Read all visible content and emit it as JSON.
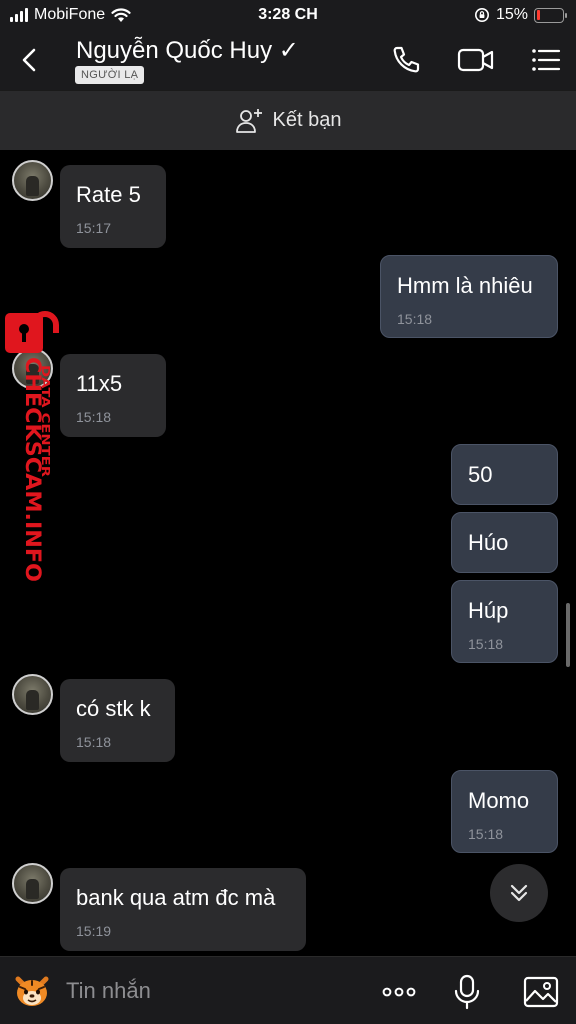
{
  "status_bar": {
    "carrier": "MobiFone",
    "time": "3:28 CH",
    "battery": "15%",
    "battery_level": 0.15,
    "battery_color": "#ff3b30"
  },
  "header": {
    "contact_name": "Nguyễn Quốc Huy ✓",
    "badge": "NGƯỜI LẠ",
    "icons": [
      "back-icon",
      "phone-icon",
      "video-call-icon",
      "menu-icon"
    ]
  },
  "add_friend": {
    "label": "Kết bạn",
    "icon": "add-friend-icon"
  },
  "messages": [
    {
      "direction": "in",
      "text": "Rate 5",
      "time": "15:17"
    },
    {
      "direction": "out",
      "text": "Hmm là nhiêu",
      "time": "15:18"
    },
    {
      "direction": "in",
      "text": "11x5",
      "time": "15:18"
    },
    {
      "direction": "out",
      "text": "50",
      "time": ""
    },
    {
      "direction": "out",
      "text": "Húo",
      "time": ""
    },
    {
      "direction": "out",
      "text": "Húp",
      "time": "15:18"
    },
    {
      "direction": "in",
      "text": "có stk k",
      "time": "15:18"
    },
    {
      "direction": "out",
      "text": "Momo",
      "time": "15:18"
    },
    {
      "direction": "in",
      "text": "bank qua atm đc mà",
      "time": "15:19"
    }
  ],
  "watermark": {
    "line1": "CHECKSCAM.INFO",
    "line2": "DATA CENTER",
    "color": "#e0161e"
  },
  "input_bar": {
    "placeholder": "Tin nhắn",
    "icons": [
      "sticker-icon",
      "more-icon",
      "microphone-icon",
      "image-icon"
    ]
  },
  "colors": {
    "incoming_bubble": "#2b2b2d",
    "outgoing_bubble": "#353c49",
    "header_bg": "#1b1b1d",
    "timestamp": "#8f939b"
  }
}
